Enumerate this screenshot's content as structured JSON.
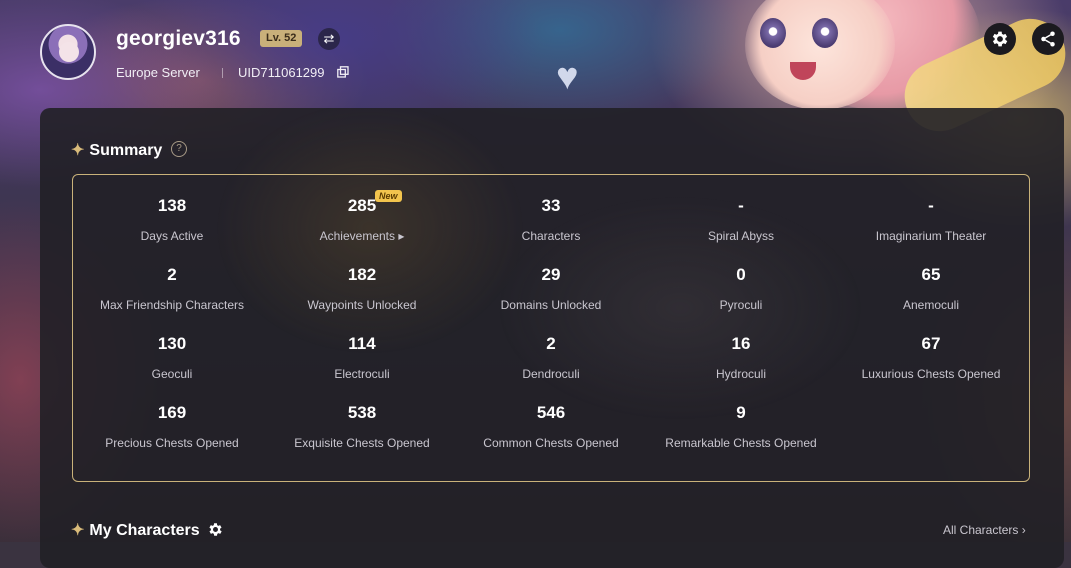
{
  "profile": {
    "username": "georgiev316",
    "level": "Lv. 52",
    "server": "Europe Server",
    "uid": "UID711061299"
  },
  "icons": {
    "switch": "swap-arrows-icon",
    "copy": "copy-icon",
    "settings": "gear-icon",
    "share": "share-icon",
    "help": "question-icon",
    "sparkle": "sparkle-icon"
  },
  "summary": {
    "title": "Summary",
    "new_badge": "New",
    "stats": [
      {
        "value": "138",
        "label": "Days Active"
      },
      {
        "value": "285",
        "label": "Achievements ▸"
      },
      {
        "value": "33",
        "label": "Characters"
      },
      {
        "value": "-",
        "label": "Spiral Abyss"
      },
      {
        "value": "-",
        "label": "Imaginarium Theater"
      },
      {
        "value": "2",
        "label": "Max Friendship Characters"
      },
      {
        "value": "182",
        "label": "Waypoints Unlocked"
      },
      {
        "value": "29",
        "label": "Domains Unlocked"
      },
      {
        "value": "0",
        "label": "Pyroculi"
      },
      {
        "value": "65",
        "label": "Anemoculi"
      },
      {
        "value": "130",
        "label": "Geoculi"
      },
      {
        "value": "114",
        "label": "Electroculi"
      },
      {
        "value": "2",
        "label": "Dendroculi"
      },
      {
        "value": "16",
        "label": "Hydroculi"
      },
      {
        "value": "67",
        "label": "Luxurious Chests Opened"
      },
      {
        "value": "169",
        "label": "Precious Chests Opened"
      },
      {
        "value": "538",
        "label": "Exquisite Chests Opened"
      },
      {
        "value": "546",
        "label": "Common Chests Opened"
      },
      {
        "value": "9",
        "label": "Remarkable Chests Opened"
      }
    ]
  },
  "characters": {
    "title": "My Characters",
    "all_link": "All Characters ›"
  },
  "colors": {
    "accent_gold": "#c9b27a",
    "new_badge": "#f2c44d",
    "panel": "#212026"
  }
}
